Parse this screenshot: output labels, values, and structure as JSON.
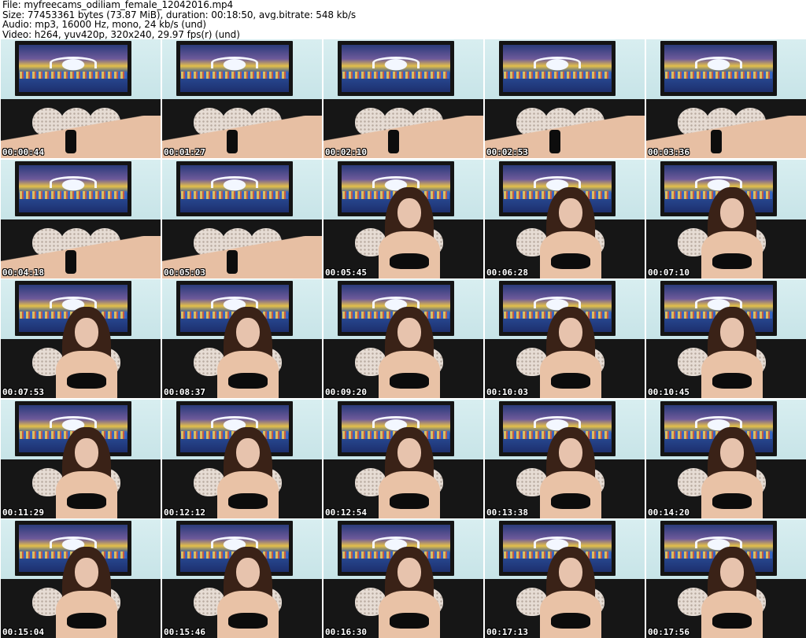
{
  "header": {
    "file": "File: myfreecams_odiliam_female_12042016.mp4",
    "size": "Size: 77453361 bytes (73.87 MiB), duration: 00:18:50, avg.bitrate: 548 kb/s",
    "audio": "Audio: mp3, 16000 Hz, mono, 24 kb/s (und)",
    "video": "Video: h264, yuv420p, 320x240, 29.97 fps(r) (und)"
  },
  "thumbnails": [
    {
      "time": "00:00:44",
      "scene": "lying"
    },
    {
      "time": "00:01:27",
      "scene": "lying"
    },
    {
      "time": "00:02:10",
      "scene": "lying"
    },
    {
      "time": "00:02:53",
      "scene": "lying"
    },
    {
      "time": "00:03:36",
      "scene": "lying"
    },
    {
      "time": "00:04:18",
      "scene": "lying"
    },
    {
      "time": "00:05:03",
      "scene": "lying"
    },
    {
      "time": "00:05:45",
      "scene": "sitting"
    },
    {
      "time": "00:06:28",
      "scene": "sitting"
    },
    {
      "time": "00:07:10",
      "scene": "sitting"
    },
    {
      "time": "00:07:53",
      "scene": "sitting"
    },
    {
      "time": "00:08:37",
      "scene": "sitting"
    },
    {
      "time": "00:09:20",
      "scene": "sitting"
    },
    {
      "time": "00:10:03",
      "scene": "sitting"
    },
    {
      "time": "00:10:45",
      "scene": "sitting"
    },
    {
      "time": "00:11:29",
      "scene": "sitting"
    },
    {
      "time": "00:12:12",
      "scene": "sitting"
    },
    {
      "time": "00:12:54",
      "scene": "sitting"
    },
    {
      "time": "00:13:38",
      "scene": "sitting"
    },
    {
      "time": "00:14:20",
      "scene": "sitting"
    },
    {
      "time": "00:15:04",
      "scene": "sitting"
    },
    {
      "time": "00:15:46",
      "scene": "sitting"
    },
    {
      "time": "00:16:30",
      "scene": "sitting"
    },
    {
      "time": "00:17:13",
      "scene": "sitting"
    },
    {
      "time": "00:17:56",
      "scene": "sitting"
    }
  ]
}
